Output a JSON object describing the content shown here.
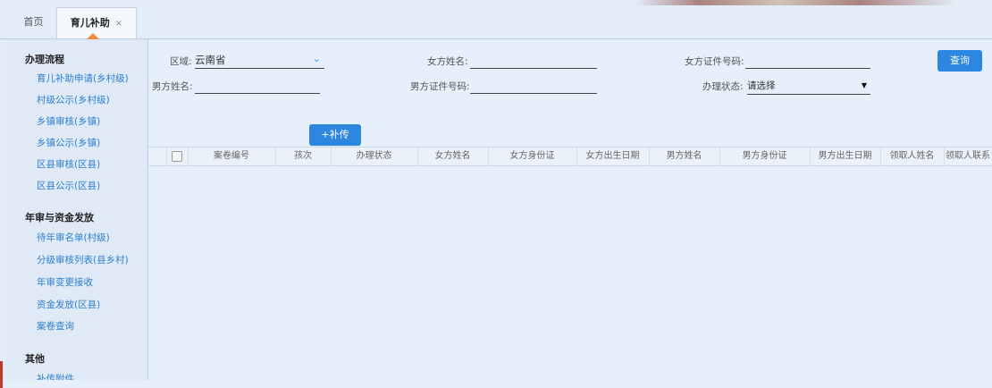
{
  "tabs": {
    "home": "首页",
    "active": "育儿补助",
    "close": "×"
  },
  "sidebar": {
    "sections": [
      {
        "title": "办理流程",
        "items": [
          "育儿补助申请(乡村级)",
          "村级公示(乡村级)",
          "乡镇审核(乡镇)",
          "乡镇公示(乡镇)",
          "区县审核(区县)",
          "区县公示(区县)"
        ]
      },
      {
        "title": "年审与资金发放",
        "items": [
          "待年审名单(村级)",
          "分级审核列表(县乡村)",
          "年审变更接收",
          "资金发放(区县)",
          "案卷查询"
        ]
      },
      {
        "title": "其他",
        "items": [
          "补传附件"
        ]
      }
    ]
  },
  "search": {
    "region_label": "区域:",
    "region_value": "云南省",
    "female_name_label": "女方姓名:",
    "female_name_value": "",
    "female_id_label": "女方证件号码:",
    "female_id_value": "",
    "male_name_label": "男方姓名:",
    "male_name_value": "",
    "male_id_label": "男方证件号码:",
    "male_id_value": "",
    "status_label": "办理状态:",
    "status_value": "请选择",
    "query_button": "查询"
  },
  "actions": {
    "upload_button": "+补传"
  },
  "table": {
    "columns": [
      "案卷编号",
      "孩次",
      "办理状态",
      "女方姓名",
      "女方身份证",
      "女方出生日期",
      "男方姓名",
      "男方身份证",
      "男方出生日期",
      "领取人姓名",
      "领取人联系"
    ]
  }
}
